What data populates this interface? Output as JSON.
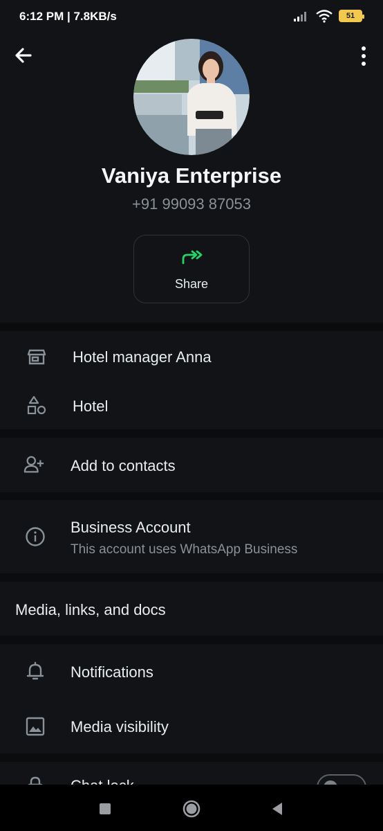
{
  "status_bar": {
    "time_speed": "6:12 PM | 7.8KB/s",
    "battery": "51"
  },
  "profile": {
    "name": "Vaniya Enterprise",
    "phone": "+91 99093 87053",
    "share_label": "Share"
  },
  "business_info": {
    "description": "Hotel manager Anna",
    "category": "Hotel"
  },
  "contacts": {
    "add_label": "Add to contacts"
  },
  "business_account": {
    "title": "Business Account",
    "subtitle": "This account uses WhatsApp Business"
  },
  "media": {
    "label": "Media, links, and docs"
  },
  "settings": {
    "notifications": "Notifications",
    "media_visibility": "Media visibility",
    "chat_lock": "Chat lock"
  },
  "colors": {
    "accent": "#25d366",
    "background": "#0b0c0e",
    "surface": "#111316",
    "secondary_text": "#8a9299"
  },
  "icons": [
    "back-arrow-icon",
    "more-vert-icon",
    "share-forward-icon",
    "store-icon",
    "category-shapes-icon",
    "add-person-icon",
    "info-icon",
    "bell-icon",
    "image-icon",
    "lock-icon",
    "recents-icon",
    "home-icon",
    "back-icon"
  ]
}
